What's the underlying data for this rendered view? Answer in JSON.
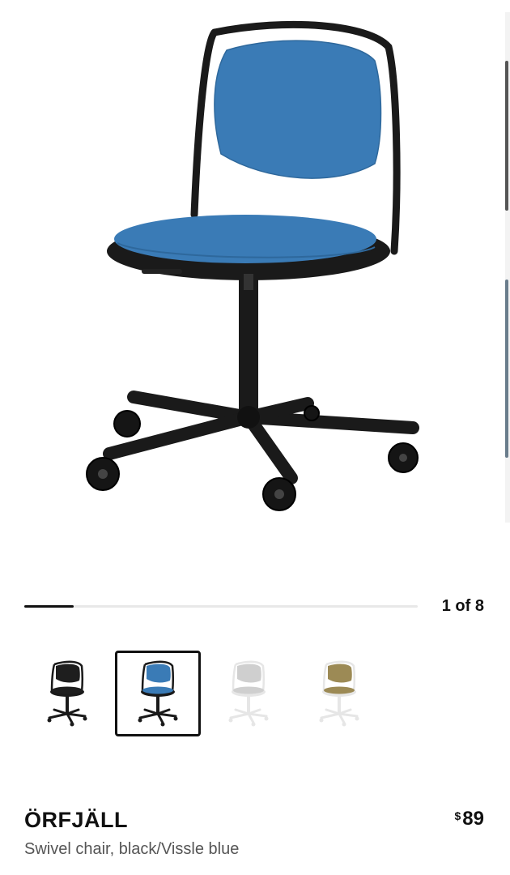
{
  "gallery": {
    "main_image": "chair-black-vissle-blue",
    "current": 1,
    "total": 8,
    "counter_text": "1 of 8",
    "progress_fraction": 0.125,
    "thumbnails": [
      {
        "name": "chair-black",
        "seat_color": "#1e1e1e",
        "frame_color": "#1a1a1a",
        "selected": false
      },
      {
        "name": "chair-black-vissle-blue",
        "seat_color": "#3a7bb6",
        "frame_color": "#1a1a1a",
        "selected": true
      },
      {
        "name": "chair-white-grey",
        "seat_color": "#cfcfcf",
        "frame_color": "#e6e6e6",
        "selected": false
      },
      {
        "name": "chair-white-beige",
        "seat_color": "#9c8a55",
        "frame_color": "#e6e6e6",
        "selected": false
      }
    ]
  },
  "product": {
    "name": "ÖRFJÄLL",
    "description": "Swivel chair, black/Vissle blue",
    "price_currency": "$",
    "price_amount": "89"
  },
  "colors": {
    "seat_blue": "#3a7bb6",
    "frame": "#1a1a1a",
    "progress_fill": "#111111",
    "progress_track": "#e8e8e8"
  }
}
